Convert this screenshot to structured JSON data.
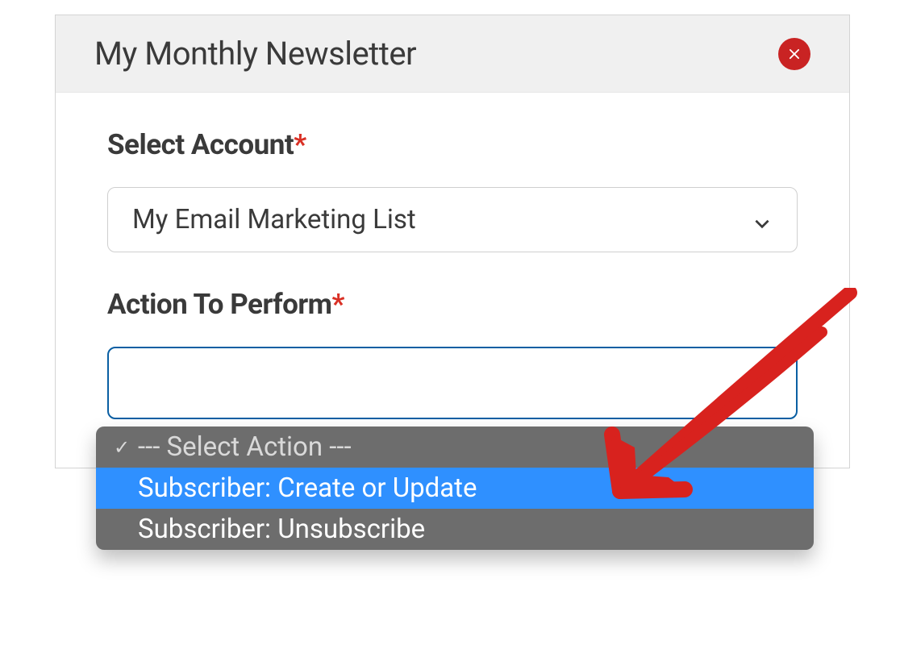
{
  "panel": {
    "title": "My Monthly Newsletter"
  },
  "fields": {
    "account": {
      "label": "Select Account",
      "required": "*",
      "value": "My Email Marketing List"
    },
    "action": {
      "label": "Action To Perform",
      "required": "*"
    }
  },
  "dropdown": {
    "checkmark": "✓",
    "options": [
      {
        "label": "--- Select Action ---",
        "selected": true,
        "highlighted": false,
        "placeholder": true
      },
      {
        "label": "Subscriber: Create or Update",
        "selected": false,
        "highlighted": true,
        "placeholder": false
      },
      {
        "label": "Subscriber: Unsubscribe",
        "selected": false,
        "highlighted": false,
        "placeholder": false
      }
    ]
  },
  "colors": {
    "close_button": "#c92323",
    "highlight": "#2f90ff",
    "dropdown_bg": "#6d6d6d",
    "active_border": "#0a5fa3",
    "annotation": "#d8221e"
  }
}
